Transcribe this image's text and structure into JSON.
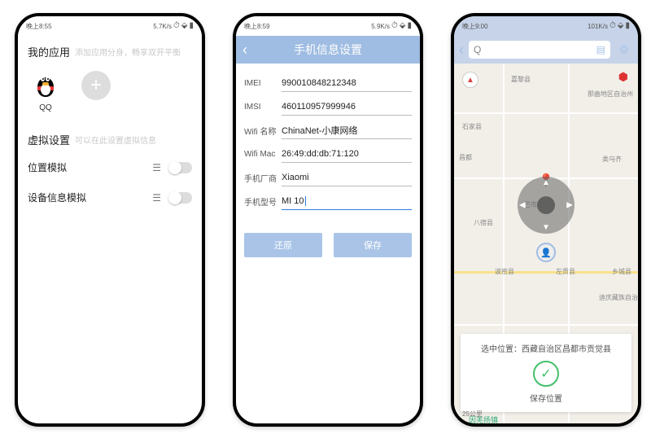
{
  "phone1": {
    "status": {
      "time": "晚上8:55",
      "net": "5.7K/s"
    },
    "sections": {
      "apps": {
        "title": "我的应用",
        "subtitle": "添加应用分身，畅享双开平衡"
      },
      "virtual": {
        "title": "虚拟设置",
        "subtitle": "可以在此设置虚拟信息"
      }
    },
    "apps": [
      {
        "name": "QQ"
      }
    ],
    "rows": {
      "location": "位置模拟",
      "device": "设备信息模拟"
    }
  },
  "phone2": {
    "status": {
      "time": "晚上8:59",
      "net": "5.9K/s"
    },
    "header": "手机信息设置",
    "fields": {
      "imei": {
        "label": "IMEI",
        "value": "990010848212348"
      },
      "imsi": {
        "label": "IMSI",
        "value": "460110957999946"
      },
      "wname": {
        "label": "Wifi 名称",
        "value": "ChinaNet-小康网络"
      },
      "wmac": {
        "label": "Wifi Mac",
        "value": "26:49:dd:db:71:120"
      },
      "vendor": {
        "label": "手机厂商",
        "value": "Xiaomi"
      },
      "model": {
        "label": "手机型号",
        "value": "MI 10"
      }
    },
    "buttons": {
      "reset": "还原",
      "save": "保存"
    }
  },
  "phone3": {
    "status": {
      "time": "晚上9:00",
      "net": "101K/s"
    },
    "search_placeholder": "Q",
    "places": {
      "a": "嘉黎县",
      "b": "那曲地区自治州",
      "c": "石家县",
      "d": "昌都",
      "e": "八宿县",
      "f": "巴市",
      "g": "类乌齐",
      "h": "波密县",
      "i": "左贡县",
      "j": "乡城县",
      "k": "迪庆藏族自治",
      "l": "因羌扬镇"
    },
    "card": {
      "line": "选中位置：西藏自治区昌都市贡觉县",
      "save": "保存位置"
    },
    "scale": "25公里"
  }
}
